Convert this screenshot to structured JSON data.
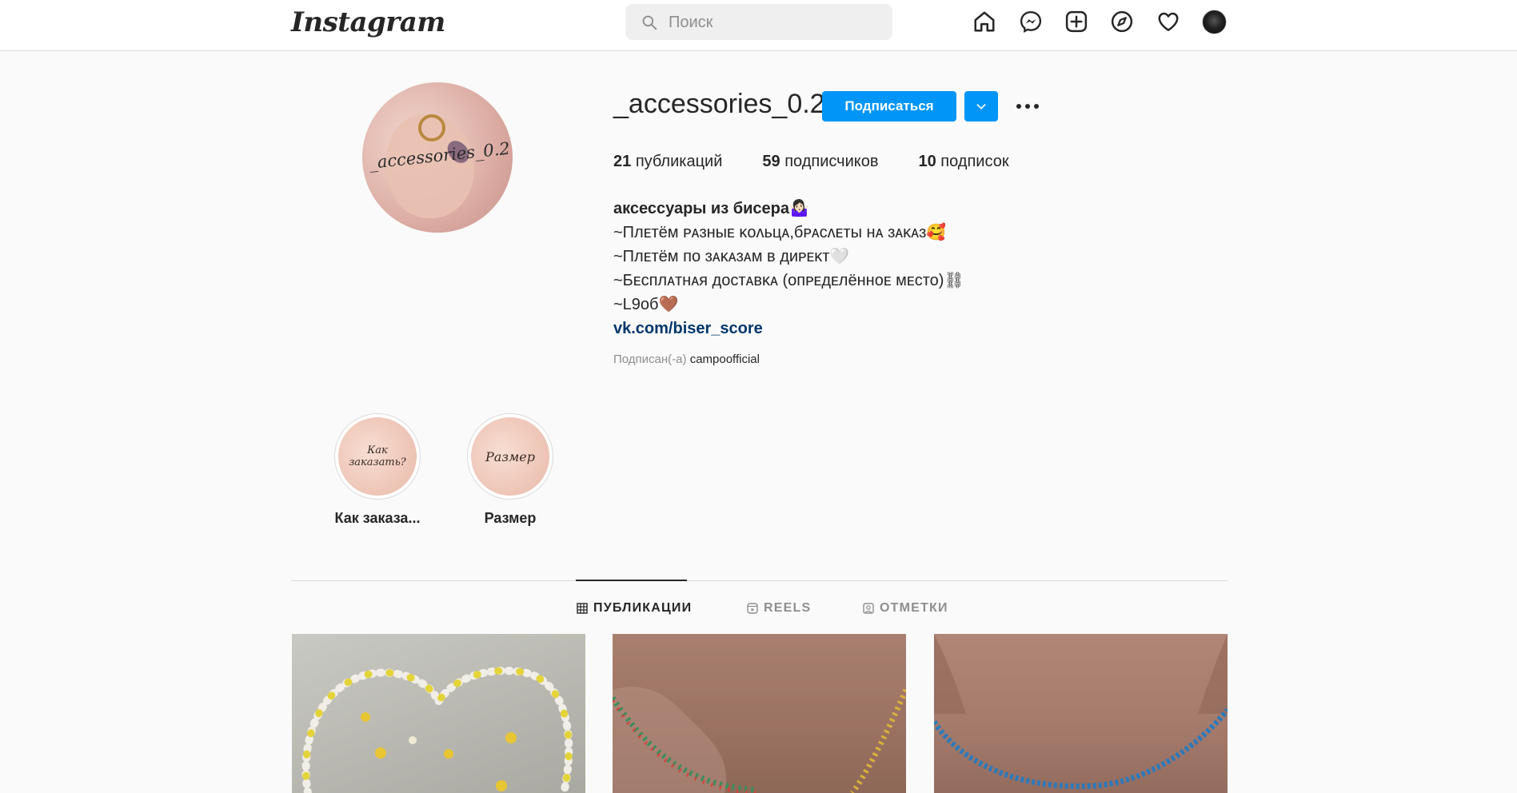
{
  "header": {
    "logo": "Instagram",
    "search_placeholder": "Поиск",
    "nav_icons": [
      "home-icon",
      "messenger-icon",
      "new-post-icon",
      "explore-icon",
      "activity-heart-icon",
      "profile-avatar"
    ]
  },
  "profile": {
    "avatar_text": "_accessories_0.2",
    "username": "_accessories_0.2",
    "follow_label": "Подписаться",
    "stats": [
      {
        "count": "21",
        "label": "публикаций"
      },
      {
        "count": "59",
        "label": "подписчиков"
      },
      {
        "count": "10",
        "label": "подписок"
      }
    ],
    "bio": {
      "name": "аксессуары из бисера🤷🏻‍♀️",
      "lines": [
        "~Плᴇтёᴍ ᴩᴀɜныᴇ ᴋоᴧьцᴀ,бᴩᴀᴄᴧᴇты нᴀ ɜᴀᴋᴀɜ🥰",
        "~Плᴇтёᴍ по ɜᴀᴋᴀɜᴀᴍ ʙ дᴎᴩᴇᴋт🤍",
        "~Бᴇᴄплᴀтнᴀя доᴄтᴀʙᴋᴀ (опᴩᴇдᴇлённоᴇ ᴍᴇᴄто)⛓",
        "~L9об🤎"
      ],
      "link": "vk.com/biser_score"
    },
    "followed_by_prefix": "Подписан(-а)",
    "followed_by_account": "campoofficial"
  },
  "highlights": [
    {
      "cover_text": "Как заказать?",
      "label": "Как заказа..."
    },
    {
      "cover_text": "Размер",
      "label": "Размер"
    }
  ],
  "tabs": [
    {
      "label": "ПУБЛИКАЦИИ",
      "active": true
    },
    {
      "label": "REELS",
      "active": false
    },
    {
      "label": "ОТМЕТКИ",
      "active": false
    }
  ],
  "colors": {
    "accent": "#0095f6",
    "link": "#00376b",
    "background": "#fafafa",
    "border": "#dbdbdb"
  }
}
